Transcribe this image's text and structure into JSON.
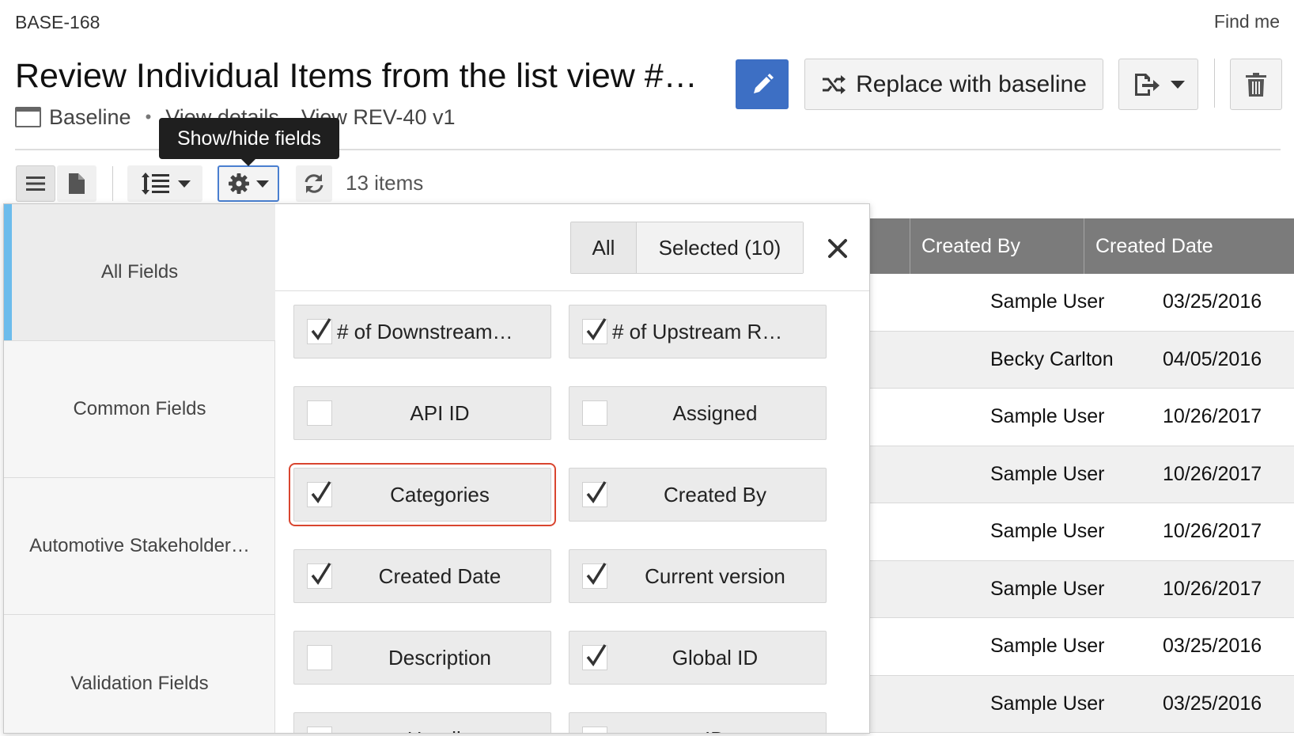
{
  "header": {
    "breadcrumb": "BASE-168",
    "find_me": "Find me",
    "title": "Review Individual Items from the list view #…",
    "sub_label": "Baseline",
    "sub_link_details": "View details",
    "sub_link_rev": "View REV-40 v1",
    "replace_label": "Replace with baseline"
  },
  "toolbar": {
    "tooltip": "Show/hide fields",
    "items_count": "13 items"
  },
  "popup": {
    "categories": [
      {
        "label": "All Fields",
        "active": true
      },
      {
        "label": "Common Fields",
        "active": false
      },
      {
        "label": "Automotive Stakeholder…",
        "active": false
      },
      {
        "label": "Validation Fields",
        "active": false
      }
    ],
    "filter_all": "All",
    "filter_selected": "Selected (10)",
    "fields": [
      {
        "label": "# of Downstream…",
        "checked": true
      },
      {
        "label": "# of Upstream R…",
        "checked": true
      },
      {
        "label": "API ID",
        "checked": false
      },
      {
        "label": "Assigned",
        "checked": false
      },
      {
        "label": "Categories",
        "checked": true
      },
      {
        "label": "Created By",
        "checked": true
      },
      {
        "label": "Created Date",
        "checked": true
      },
      {
        "label": "Current version",
        "checked": true
      },
      {
        "label": "Description",
        "checked": false
      },
      {
        "label": "Global ID",
        "checked": true
      },
      {
        "label": "Headin",
        "checked": false
      },
      {
        "label": "ID",
        "checked": false
      }
    ]
  },
  "grid": {
    "columns": [
      "Created By",
      "Created Date"
    ],
    "rows": [
      [
        "Sample User",
        "03/25/2016"
      ],
      [
        "Becky Carlton",
        "04/05/2016"
      ],
      [
        "Sample User",
        "10/26/2017"
      ],
      [
        "Sample User",
        "10/26/2017"
      ],
      [
        "Sample User",
        "10/26/2017"
      ],
      [
        "Sample User",
        "10/26/2017"
      ],
      [
        "Sample User",
        "03/25/2016"
      ],
      [
        "Sample User",
        "03/25/2016"
      ]
    ]
  },
  "colors": {
    "primary": "#3d6fc4",
    "highlight": "#d9452f",
    "active_tab": "#6cbcec",
    "grid_header": "#7b7b7b"
  }
}
